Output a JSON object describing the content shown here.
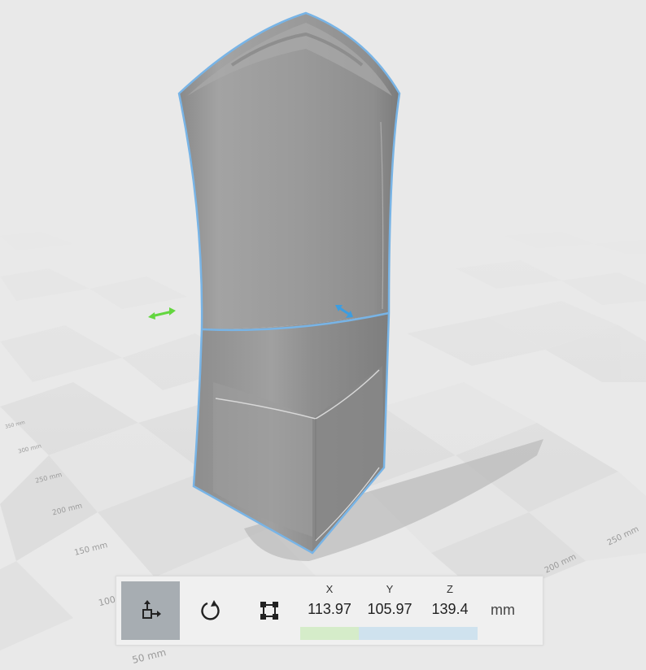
{
  "ruler": {
    "ticks": [
      "50 mm",
      "100",
      "150 mm",
      "200 mm",
      "250 mm",
      "300 mm",
      "350 mm",
      "200 mm",
      "250 mm"
    ]
  },
  "toolbar": {
    "tools": [
      {
        "name": "move-tool",
        "icon": "move-icon",
        "active": true
      },
      {
        "name": "rotate-tool",
        "icon": "rotate-icon",
        "active": false
      },
      {
        "name": "scale-tool",
        "icon": "scale-icon",
        "active": false
      }
    ],
    "x_label": "X",
    "y_label": "Y",
    "z_label": "Z",
    "x_value": "113.97",
    "y_value": "105.97",
    "z_value": "139.4",
    "unit": "mm"
  },
  "colors": {
    "background": "#e9e9e9",
    "model": "#9a9a9a",
    "selection_outline": "#78b4e6",
    "x_handle": "#63d63f",
    "y_handle": "#3d9de0",
    "x_bar": "#d5ecc9",
    "y_bar": "#cfe2ee",
    "active_tool": "#a7adb2"
  }
}
